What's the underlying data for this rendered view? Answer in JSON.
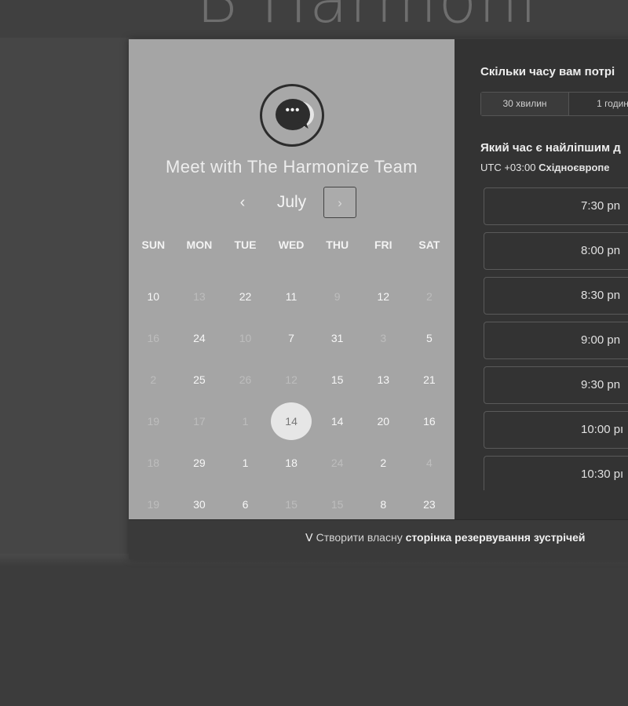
{
  "page": {
    "heading_fragment": "B Harmoni"
  },
  "scheduler": {
    "logo_icon": "chat-bubble-ellipsis-icon",
    "logo_glyph": "•••",
    "title": "Meet with The Harmonize Team",
    "month": "July",
    "prev_glyph": "‹",
    "next_glyph": "›",
    "weekdays": [
      "SUN",
      "MON",
      "TUE",
      "WED",
      "THU",
      "FRI",
      "SAT"
    ],
    "weeks": [
      [
        {
          "d": "10",
          "dim": false
        },
        {
          "d": "13",
          "dim": true
        },
        {
          "d": "22",
          "dim": false
        },
        {
          "d": "11",
          "dim": false
        },
        {
          "d": "9",
          "dim": true
        },
        {
          "d": "12",
          "dim": false
        },
        {
          "d": "2",
          "dim": true
        }
      ],
      [
        {
          "d": "16",
          "dim": true
        },
        {
          "d": "24",
          "dim": false
        },
        {
          "d": "10",
          "dim": true
        },
        {
          "d": "7",
          "dim": false
        },
        {
          "d": "31",
          "dim": false
        },
        {
          "d": "3",
          "dim": true
        },
        {
          "d": "5",
          "dim": false
        }
      ],
      [
        {
          "d": "2",
          "dim": true
        },
        {
          "d": "25",
          "dim": false
        },
        {
          "d": "26",
          "dim": true
        },
        {
          "d": "12",
          "dim": true
        },
        {
          "d": "15",
          "dim": false
        },
        {
          "d": "13",
          "dim": false
        },
        {
          "d": "21",
          "dim": false
        }
      ],
      [
        {
          "d": "19",
          "dim": true
        },
        {
          "d": "17",
          "dim": true
        },
        {
          "d": "1",
          "dim": true
        },
        {
          "d": "14",
          "dim": false,
          "selected": true
        },
        {
          "d": "14",
          "dim": false
        },
        {
          "d": "20",
          "dim": false
        },
        {
          "d": "16",
          "dim": false
        }
      ],
      [
        {
          "d": "18",
          "dim": true
        },
        {
          "d": "29",
          "dim": false
        },
        {
          "d": "1",
          "dim": false
        },
        {
          "d": "18",
          "dim": false
        },
        {
          "d": "24",
          "dim": true
        },
        {
          "d": "2",
          "dim": false
        },
        {
          "d": "4",
          "dim": true
        }
      ],
      [
        {
          "d": "19",
          "dim": true
        },
        {
          "d": "30",
          "dim": false
        },
        {
          "d": "6",
          "dim": false
        },
        {
          "d": "15",
          "dim": true
        },
        {
          "d": "15",
          "dim": true
        },
        {
          "d": "8",
          "dim": false
        },
        {
          "d": "23",
          "dim": false
        }
      ]
    ],
    "duration_question": "Скільки часу вам потрі",
    "durations": [
      "30 хвилин",
      "1 годин"
    ],
    "time_question": "Який час є найліпшим д",
    "timezone_offset": "UTC +03:00",
    "timezone_name": "Східноєвропе",
    "slots": [
      "7:30 pn",
      "8:00 pn",
      "8:30 pn",
      "9:00 pn",
      "9:30 pn",
      "10:00 pı",
      "10:30 pı"
    ],
    "footer": {
      "icon": "sprocket-icon",
      "icon_glyph": "ⴸ",
      "prefix": "Створити власну",
      "bold": "сторінка резервування зустрічей"
    }
  },
  "colors": {
    "background": "#3c3c3c",
    "calendar_panel": "#a5a5a5",
    "right_panel": "#333333"
  }
}
